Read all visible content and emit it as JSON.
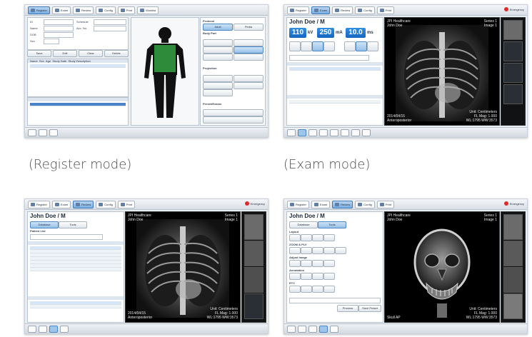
{
  "captions": {
    "register": "(Register mode)",
    "exam": "(Exam mode)"
  },
  "toolbar": {
    "items": [
      "Register",
      "Exam",
      "Review",
      "Config",
      "Print",
      "Worklist"
    ],
    "emergency": "Emergency"
  },
  "register": {
    "fields": {
      "id_label": "ID",
      "name_label": "Name",
      "dob_label": "DOB",
      "sex_label": "Sex",
      "schedule_label": "Schedule",
      "acc_label": "Acc. No."
    },
    "buttons": [
      "Save",
      "Edit",
      "Clear",
      "Delete"
    ],
    "list_headers": [
      "Name",
      "Sex",
      "Age",
      "Study Date",
      "Study Description"
    ],
    "right_panel": {
      "section1": "Protocol",
      "section2": "Body Part",
      "section3": "Projection",
      "section4": "Preset/Exams",
      "tabs": [
        "Adult",
        "Pedia"
      ]
    }
  },
  "exam": {
    "patient": "John Doe / M",
    "kv": "110",
    "kv_unit": "kV",
    "ma": "250",
    "ma_unit": "mA",
    "mas": "10.0",
    "mas_unit": "ms",
    "overlay_top_left": "JPI Healthcare\nJohn Doe",
    "overlay_top_right": "Series 1\nImage 1",
    "overlay_bottom_left": "2014/04/15\nAnteroposterior",
    "overlay_bottom_right": "Unit: Centimeters\nFL Mag: 1.000\nWL:1795 WW:3573"
  },
  "review": {
    "patient": "John Doe / M",
    "tabs": [
      "Database",
      "Tools"
    ],
    "section": "Patient List",
    "overlay_top_left": "JPI Healthcare\nJohn Doe",
    "overlay_top_right": "Series 1\nImage 1",
    "overlay_bottom_left": "2014/04/15\nAnteroposterior",
    "overlay_bottom_right": "Unit: Centimeters\nFL Mag: 1.000\nWL:1795 WW:3573"
  },
  "tools": {
    "patient": "John Doe / M",
    "tabs": [
      "Database",
      "Tools"
    ],
    "sections": [
      "Layout",
      "ZOOM & PLV",
      "Adjust Image",
      "Annotation",
      "ETC"
    ],
    "bottom_buttons": [
      "Process",
      "Save Preset"
    ],
    "overlay_top_left": "JPI Healthcare\nJohn Doe",
    "overlay_top_right": "Series 1\nImage 1",
    "overlay_bottom_left": "Skull AP",
    "overlay_bottom_right": "Unit: Centimeters\nFL Mag: 1.000\nWL:1795 WW:3573"
  },
  "colors": {
    "accent": "#1e6fcf",
    "body_highlight": "#2e8b3a",
    "emergency": "#e02a2a"
  }
}
